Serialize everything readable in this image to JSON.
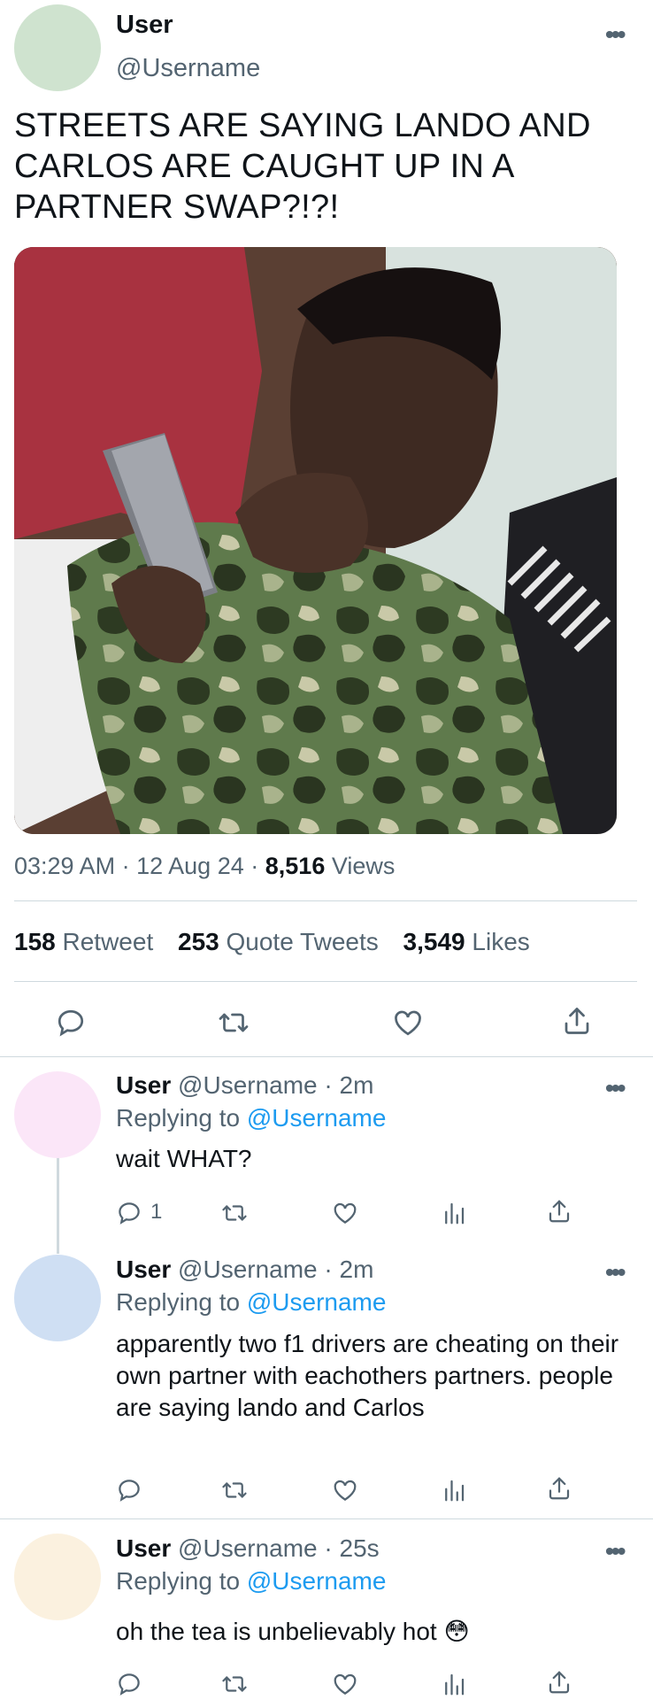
{
  "main_tweet": {
    "display_name": "User",
    "handle": "@Username",
    "text": "STREETS ARE SAYING LANDO AND CARLOS ARE CAUGHT UP IN A PARTNER SWAP?!?!",
    "time": "03:29 AM",
    "date": "12 Aug 24",
    "views_count": "8,516",
    "views_label": "Views",
    "retweets_count": "158",
    "retweets_label": "Retweet",
    "quotes_count": "253",
    "quotes_label": "Quote Tweets",
    "likes_count": "3,549",
    "likes_label": "Likes",
    "avatar_color": "#cfe3cf"
  },
  "replies": [
    {
      "display_name": "User",
      "handle": "@Username",
      "time": "2m",
      "replying_label": "Replying to",
      "replying_to": "@Username",
      "text": "wait WHAT?",
      "reply_count": "1",
      "avatar_color": "#fbe6f8"
    },
    {
      "display_name": "User",
      "handle": "@Username",
      "time": "2m",
      "replying_label": "Replying to",
      "replying_to": "@Username",
      "text": "apparently two f1 drivers are cheating on their own partner with eachothers partners. people are saying lando and Carlos",
      "avatar_color": "#cfdff3"
    },
    {
      "display_name": "User",
      "handle": "@Username",
      "time": "25s",
      "replying_label": "Replying to",
      "replying_to": "@Username",
      "text": "oh the tea is unbelievably hot 😳",
      "avatar_color": "#fbf1df"
    }
  ],
  "separator": "·",
  "more_glyph": "•••",
  "icons": [
    "reply-icon",
    "retweet-icon",
    "like-icon",
    "share-icon",
    "views-icon",
    "more-icon"
  ],
  "colors": {
    "link": "#1d9bf0",
    "secondary_text": "#536471",
    "divider": "#cfd9de"
  }
}
